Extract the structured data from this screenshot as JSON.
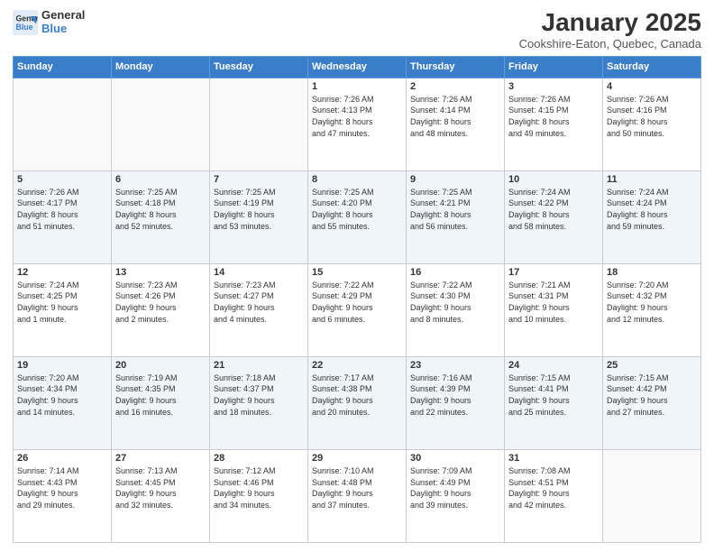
{
  "logo": {
    "general": "General",
    "blue": "Blue"
  },
  "header": {
    "month": "January 2025",
    "location": "Cookshire-Eaton, Quebec, Canada"
  },
  "weekdays": [
    "Sunday",
    "Monday",
    "Tuesday",
    "Wednesday",
    "Thursday",
    "Friday",
    "Saturday"
  ],
  "weeks": [
    [
      {
        "day": "",
        "info": ""
      },
      {
        "day": "",
        "info": ""
      },
      {
        "day": "",
        "info": ""
      },
      {
        "day": "1",
        "info": "Sunrise: 7:26 AM\nSunset: 4:13 PM\nDaylight: 8 hours\nand 47 minutes."
      },
      {
        "day": "2",
        "info": "Sunrise: 7:26 AM\nSunset: 4:14 PM\nDaylight: 8 hours\nand 48 minutes."
      },
      {
        "day": "3",
        "info": "Sunrise: 7:26 AM\nSunset: 4:15 PM\nDaylight: 8 hours\nand 49 minutes."
      },
      {
        "day": "4",
        "info": "Sunrise: 7:26 AM\nSunset: 4:16 PM\nDaylight: 8 hours\nand 50 minutes."
      }
    ],
    [
      {
        "day": "5",
        "info": "Sunrise: 7:26 AM\nSunset: 4:17 PM\nDaylight: 8 hours\nand 51 minutes."
      },
      {
        "day": "6",
        "info": "Sunrise: 7:25 AM\nSunset: 4:18 PM\nDaylight: 8 hours\nand 52 minutes."
      },
      {
        "day": "7",
        "info": "Sunrise: 7:25 AM\nSunset: 4:19 PM\nDaylight: 8 hours\nand 53 minutes."
      },
      {
        "day": "8",
        "info": "Sunrise: 7:25 AM\nSunset: 4:20 PM\nDaylight: 8 hours\nand 55 minutes."
      },
      {
        "day": "9",
        "info": "Sunrise: 7:25 AM\nSunset: 4:21 PM\nDaylight: 8 hours\nand 56 minutes."
      },
      {
        "day": "10",
        "info": "Sunrise: 7:24 AM\nSunset: 4:22 PM\nDaylight: 8 hours\nand 58 minutes."
      },
      {
        "day": "11",
        "info": "Sunrise: 7:24 AM\nSunset: 4:24 PM\nDaylight: 8 hours\nand 59 minutes."
      }
    ],
    [
      {
        "day": "12",
        "info": "Sunrise: 7:24 AM\nSunset: 4:25 PM\nDaylight: 9 hours\nand 1 minute."
      },
      {
        "day": "13",
        "info": "Sunrise: 7:23 AM\nSunset: 4:26 PM\nDaylight: 9 hours\nand 2 minutes."
      },
      {
        "day": "14",
        "info": "Sunrise: 7:23 AM\nSunset: 4:27 PM\nDaylight: 9 hours\nand 4 minutes."
      },
      {
        "day": "15",
        "info": "Sunrise: 7:22 AM\nSunset: 4:29 PM\nDaylight: 9 hours\nand 6 minutes."
      },
      {
        "day": "16",
        "info": "Sunrise: 7:22 AM\nSunset: 4:30 PM\nDaylight: 9 hours\nand 8 minutes."
      },
      {
        "day": "17",
        "info": "Sunrise: 7:21 AM\nSunset: 4:31 PM\nDaylight: 9 hours\nand 10 minutes."
      },
      {
        "day": "18",
        "info": "Sunrise: 7:20 AM\nSunset: 4:32 PM\nDaylight: 9 hours\nand 12 minutes."
      }
    ],
    [
      {
        "day": "19",
        "info": "Sunrise: 7:20 AM\nSunset: 4:34 PM\nDaylight: 9 hours\nand 14 minutes."
      },
      {
        "day": "20",
        "info": "Sunrise: 7:19 AM\nSunset: 4:35 PM\nDaylight: 9 hours\nand 16 minutes."
      },
      {
        "day": "21",
        "info": "Sunrise: 7:18 AM\nSunset: 4:37 PM\nDaylight: 9 hours\nand 18 minutes."
      },
      {
        "day": "22",
        "info": "Sunrise: 7:17 AM\nSunset: 4:38 PM\nDaylight: 9 hours\nand 20 minutes."
      },
      {
        "day": "23",
        "info": "Sunrise: 7:16 AM\nSunset: 4:39 PM\nDaylight: 9 hours\nand 22 minutes."
      },
      {
        "day": "24",
        "info": "Sunrise: 7:15 AM\nSunset: 4:41 PM\nDaylight: 9 hours\nand 25 minutes."
      },
      {
        "day": "25",
        "info": "Sunrise: 7:15 AM\nSunset: 4:42 PM\nDaylight: 9 hours\nand 27 minutes."
      }
    ],
    [
      {
        "day": "26",
        "info": "Sunrise: 7:14 AM\nSunset: 4:43 PM\nDaylight: 9 hours\nand 29 minutes."
      },
      {
        "day": "27",
        "info": "Sunrise: 7:13 AM\nSunset: 4:45 PM\nDaylight: 9 hours\nand 32 minutes."
      },
      {
        "day": "28",
        "info": "Sunrise: 7:12 AM\nSunset: 4:46 PM\nDaylight: 9 hours\nand 34 minutes."
      },
      {
        "day": "29",
        "info": "Sunrise: 7:10 AM\nSunset: 4:48 PM\nDaylight: 9 hours\nand 37 minutes."
      },
      {
        "day": "30",
        "info": "Sunrise: 7:09 AM\nSunset: 4:49 PM\nDaylight: 9 hours\nand 39 minutes."
      },
      {
        "day": "31",
        "info": "Sunrise: 7:08 AM\nSunset: 4:51 PM\nDaylight: 9 hours\nand 42 minutes."
      },
      {
        "day": "",
        "info": ""
      }
    ]
  ]
}
